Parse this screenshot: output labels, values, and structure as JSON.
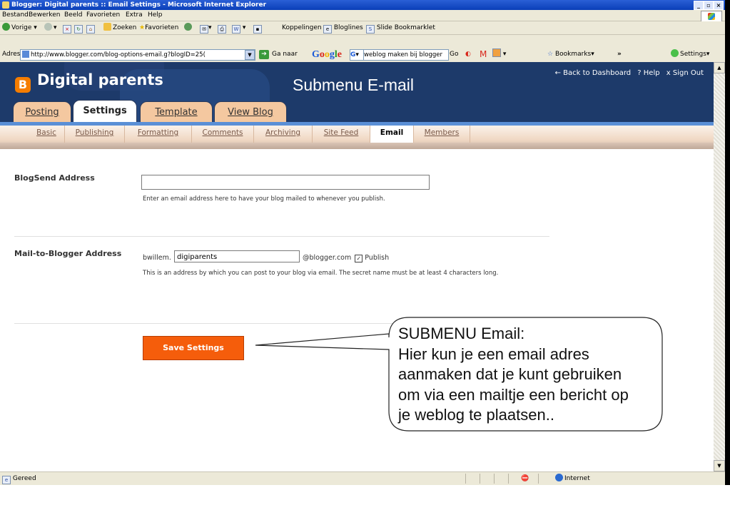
{
  "window": {
    "title": "Blogger: Digital parents :: Email Settings - Microsoft Internet Explorer"
  },
  "menubar": [
    "Bestand",
    "Bewerken",
    "Beeld",
    "Favorieten",
    "Extra",
    "Help"
  ],
  "toolbar": {
    "back": "Vorige",
    "search": "Zoeken",
    "favorites": "Favorieten",
    "links": "Koppelingen",
    "bloglines": "Bloglines",
    "slide": "Slide Bookmarklet"
  },
  "addressbar": {
    "label": "Adres",
    "url": "http://www.blogger.com/blog-options-email.g?blogID=25(",
    "go": "Ga naar",
    "google": "Google",
    "google_g": "G",
    "google_query": "weblog maken bij blogger",
    "google_go": "Go",
    "bookmarks": "Bookmarks",
    "more": "»",
    "settings": "Settings"
  },
  "blogger": {
    "logo_letter": "B",
    "blog_name": "Digital parents",
    "submenu_title": "Submenu E-mail",
    "top_links": [
      "← Back to Dashboard",
      "? Help",
      "x Sign Out"
    ],
    "tabs": [
      "Posting",
      "Settings",
      "Template",
      "View Blog"
    ],
    "subnav": [
      "Basic",
      "Publishing",
      "Formatting",
      "Comments",
      "Archiving",
      "Site Feed",
      "Email",
      "Members"
    ]
  },
  "form": {
    "blogsend_label": "BlogSend Address",
    "blogsend_hint": "Enter an email address here to have your blog mailed to whenever you publish.",
    "mail_label": "Mail-to-Blogger Address",
    "mail_prefix": "bwillem.",
    "mail_value": "digiparents",
    "mail_suffix": "@blogger.com",
    "publish_label": "Publish",
    "publish_checked": true,
    "mail_hint": "This is an address by which you can post to your blog via email. The secret name must be at least 4 characters long.",
    "save_button": "Save Settings"
  },
  "callout": {
    "lines": [
      "SUBMENU Email:",
      "Hier kun je een email adres",
      "aanmaken dat je kunt gebruiken",
      "om via een mailtje een bericht op",
      "je weblog te plaatsen.."
    ]
  },
  "statusbar": {
    "status": "Gereed",
    "zone": "Internet"
  },
  "colors": {
    "header_bg": "#1d3a6a",
    "accent_orange": "#f55d0b",
    "tab_bg": "#f4c8a0"
  }
}
